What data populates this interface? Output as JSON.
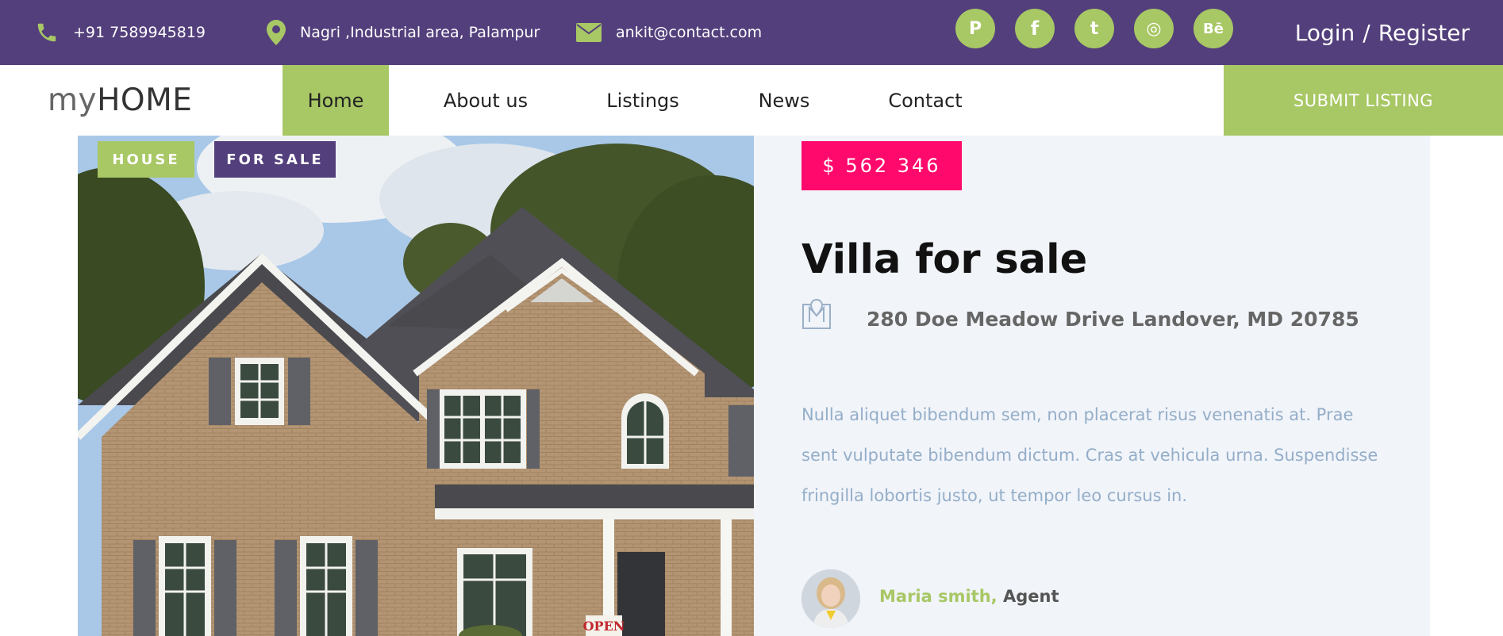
{
  "topbar": {
    "phone": "+91 7589945819",
    "location": "Nagri ,Industrial area, Palampur",
    "email": "ankit@contact.com",
    "social": [
      {
        "icon": "pinterest-icon",
        "glyph": "P"
      },
      {
        "icon": "facebook-icon",
        "glyph": "f"
      },
      {
        "icon": "twitter-icon",
        "glyph": "t"
      },
      {
        "icon": "dribbble-icon",
        "glyph": "◎"
      },
      {
        "icon": "behance-icon",
        "glyph": "Bē"
      }
    ],
    "login": "Login",
    "separator": "/",
    "register": "Register"
  },
  "nav": {
    "logo_my": "my",
    "logo_home": "HOME",
    "items": [
      "Home",
      "About us",
      "Listings",
      "News",
      "Contact"
    ],
    "active": "Home",
    "submit": "SUBMIT LISTING"
  },
  "listing": {
    "badges": [
      "HOUSE",
      "FOR SALE"
    ],
    "price": "$ 562 346",
    "title": "Villa for sale",
    "address": "280 Doe Meadow Drive Landover, MD 20785",
    "description_lines": [
      "Nulla aliquet bibendum sem, non placerat risus venenatis at. Prae",
      "sent vulputate bibendum dictum. Cras at vehicula urna. Suspendisse",
      "fringilla lobortis justo, ut tempor leo cursus in."
    ],
    "agent_name": "Maria smith,",
    "agent_role": "Agent",
    "sign_text": "OPEN"
  },
  "colors": {
    "primary": "#533f7c",
    "accent": "#a8c765",
    "price": "#ff0a6c",
    "panel": "#f1f4f9",
    "description": "#94aec9"
  }
}
